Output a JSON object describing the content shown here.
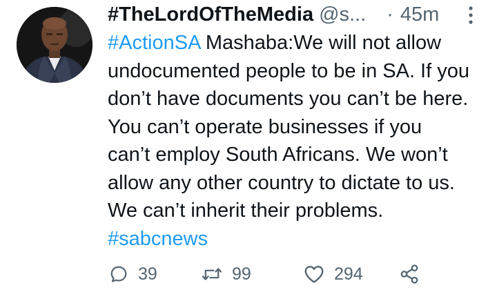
{
  "tweet": {
    "display_name": "#TheLordOfTheMedia",
    "handle": "@s...",
    "separator": "·",
    "time": "45m",
    "body": {
      "hashtag_start": "#ActionSA",
      "line1_rest": " Mashaba:We will not allow",
      "line2": "undocumented people to be in SA. If you",
      "line3": "don’t have documents you can’t be here.",
      "line4": "You can’t operate businesses if you",
      "line5": "can’t employ South Africans. We won’t",
      "line6": "allow any other country to dictate to us.",
      "line7": "We can’t inherit their problems.",
      "hashtag_end": "#sabcnews"
    },
    "actions": {
      "reply_count": "39",
      "retweet_count": "99",
      "like_count": "294"
    }
  },
  "icons": {
    "more": "more-vertical-icon",
    "reply": "reply-icon",
    "retweet": "retweet-icon",
    "like": "heart-icon",
    "share": "share-icon"
  },
  "colors": {
    "text": "#0f1419",
    "secondary": "#536471",
    "link": "#1d9bf0",
    "background": "#ffffff"
  }
}
